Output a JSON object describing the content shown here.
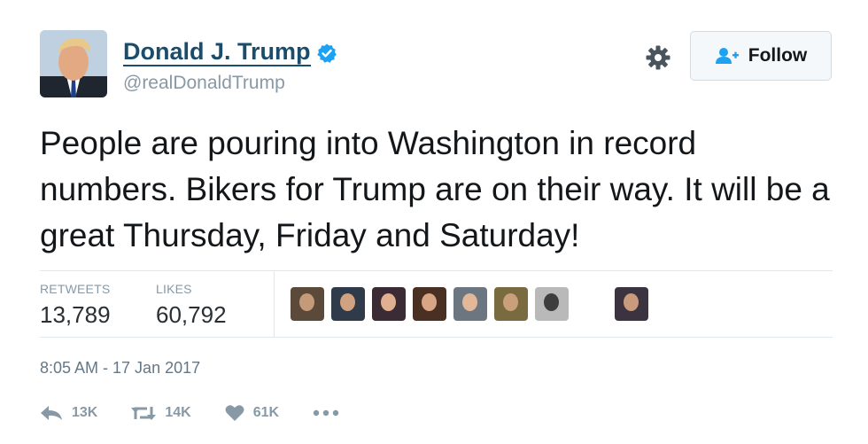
{
  "profile": {
    "display_name": "Donald J. Trump",
    "handle": "@realDonaldTrump",
    "verified_icon": "verified-badge-icon"
  },
  "header": {
    "gear_icon": "gear-icon",
    "follow_label": "Follow",
    "follow_icon": "add-user-icon"
  },
  "tweet": {
    "text": "People are pouring into Washington in record numbers. Bikers for Trump are on their way. It will be a great Thursday, Friday and Saturday!"
  },
  "stats": {
    "retweets_label": "RETWEETS",
    "retweets_value": "13,789",
    "likes_label": "LIKES",
    "likes_value": "60,792"
  },
  "likers": [
    {
      "name": "liker-avatar-1",
      "bg": "#5b4a3a",
      "face": "#c49a78"
    },
    {
      "name": "liker-avatar-2",
      "bg": "#2f3a4a",
      "face": "#d0a27f"
    },
    {
      "name": "liker-avatar-3",
      "bg": "#3a2b35",
      "face": "#e0b090"
    },
    {
      "name": "liker-avatar-4",
      "bg": "#4a3022",
      "face": "#d9a685"
    },
    {
      "name": "liker-avatar-5",
      "bg": "#6c7680",
      "face": "#e2b899"
    },
    {
      "name": "liker-avatar-6",
      "bg": "#7a6a40",
      "face": "#caa07a"
    },
    {
      "name": "liker-avatar-7",
      "bg": "#b9b9b9",
      "face": "#3d3d3d"
    },
    {
      "name": "liker-avatar-8",
      "bg": "#3b3340",
      "face": "#c99b7c"
    }
  ],
  "timestamp": "8:05 AM - 17 Jan 2017",
  "actions": {
    "reply_count": "13K",
    "retweet_count": "14K",
    "like_count": "61K",
    "more_icon": "more-icon"
  },
  "colors": {
    "name": "#1a4d6b",
    "verified": "#1da1f2",
    "secondary": "#8899a6",
    "follow_icon": "#1da1f2"
  }
}
